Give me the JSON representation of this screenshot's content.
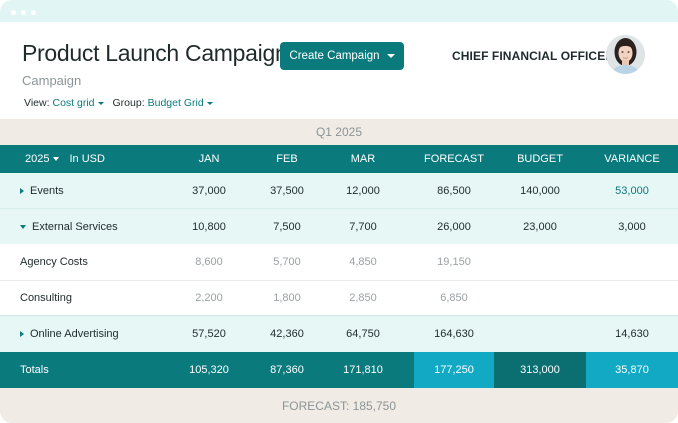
{
  "header": {
    "title": "Product Launch Campaign",
    "subtitle": "Campaign",
    "create_button": "Create Campaign",
    "role": "CHIEF FINANCIAL OFFICER"
  },
  "filters": {
    "view_label": "View:",
    "view_value": "Cost grid",
    "group_label": "Group:",
    "group_value": "Budget Grid"
  },
  "period": "Q1 2025",
  "table": {
    "year": "2025",
    "unit": "In USD",
    "columns": [
      "JAN",
      "FEB",
      "MAR",
      "FORECAST",
      "BUDGET",
      "VARIANCE"
    ],
    "rows": [
      {
        "name": "Events",
        "values": [
          "37,000",
          "37,500",
          "12,000",
          "86,500",
          "140,000",
          "53,000"
        ]
      },
      {
        "name": "External Services",
        "values": [
          "10,800",
          "7,500",
          "7,700",
          "26,000",
          "23,000",
          "3,000"
        ]
      },
      {
        "name": "Agency Costs",
        "values": [
          "8,600",
          "5,700",
          "4,850",
          "19,150",
          "",
          ""
        ]
      },
      {
        "name": "Consulting",
        "values": [
          "2,200",
          "1,800",
          "2,850",
          "6,850",
          "",
          ""
        ]
      },
      {
        "name": "Online Advertising",
        "values": [
          "57,520",
          "42,360",
          "64,750",
          "164,630",
          "",
          "14,630"
        ]
      }
    ],
    "totals": {
      "label": "Totals",
      "values": [
        "105,320",
        "87,360",
        "171,810",
        "177,250",
        "313,000",
        "35,870"
      ]
    }
  },
  "footer": "FORECAST: 185,750",
  "colors": {
    "accent": "#0b7a7d",
    "highlight": "#12a9c4",
    "row_tint": "#e6f7f6",
    "band": "#f0ebe5"
  }
}
